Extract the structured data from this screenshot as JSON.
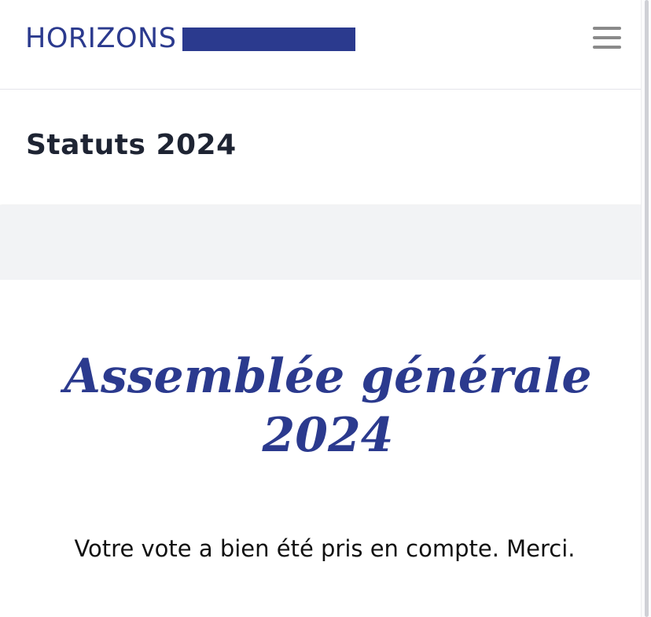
{
  "header": {
    "logo_text": "HORIZONS",
    "menu_icon": "hamburger-menu-icon",
    "brand_color": "#2b3a8e"
  },
  "title_band": {
    "title": "Statuts 2024"
  },
  "main": {
    "headline_line1": "Assemblée générale",
    "headline_line2": "2024",
    "message": "Votre vote a bien été pris en compte. Merci."
  }
}
